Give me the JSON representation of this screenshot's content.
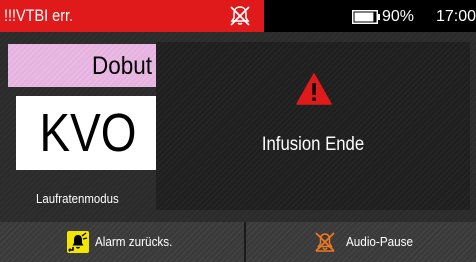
{
  "status_bar": {
    "alarm_text": "!!!VTBI err.",
    "alarm_color": "#e01a1a",
    "mute_icon": "alarm-muted-icon",
    "battery_icon": "battery-icon",
    "battery_level_percent": 90,
    "battery_text": "90%",
    "clock": "17:00"
  },
  "drug": {
    "name": "Dobut",
    "color": "#e6b2df"
  },
  "mode": {
    "value": "KVO",
    "label": "Laufratenmodus"
  },
  "alarm_popup": {
    "icon": "warning-icon",
    "icon_color": "#e01a1a",
    "message": "Infusion Ende"
  },
  "buttons": {
    "reset_alarm": {
      "label": "Alarm zurücks.",
      "icon": "alarm-reset-icon",
      "icon_bg": "#f2e600"
    },
    "audio_pause": {
      "label": "Audio-Pause",
      "icon": "audio-pause-icon",
      "icon_color": "#f07820"
    }
  }
}
